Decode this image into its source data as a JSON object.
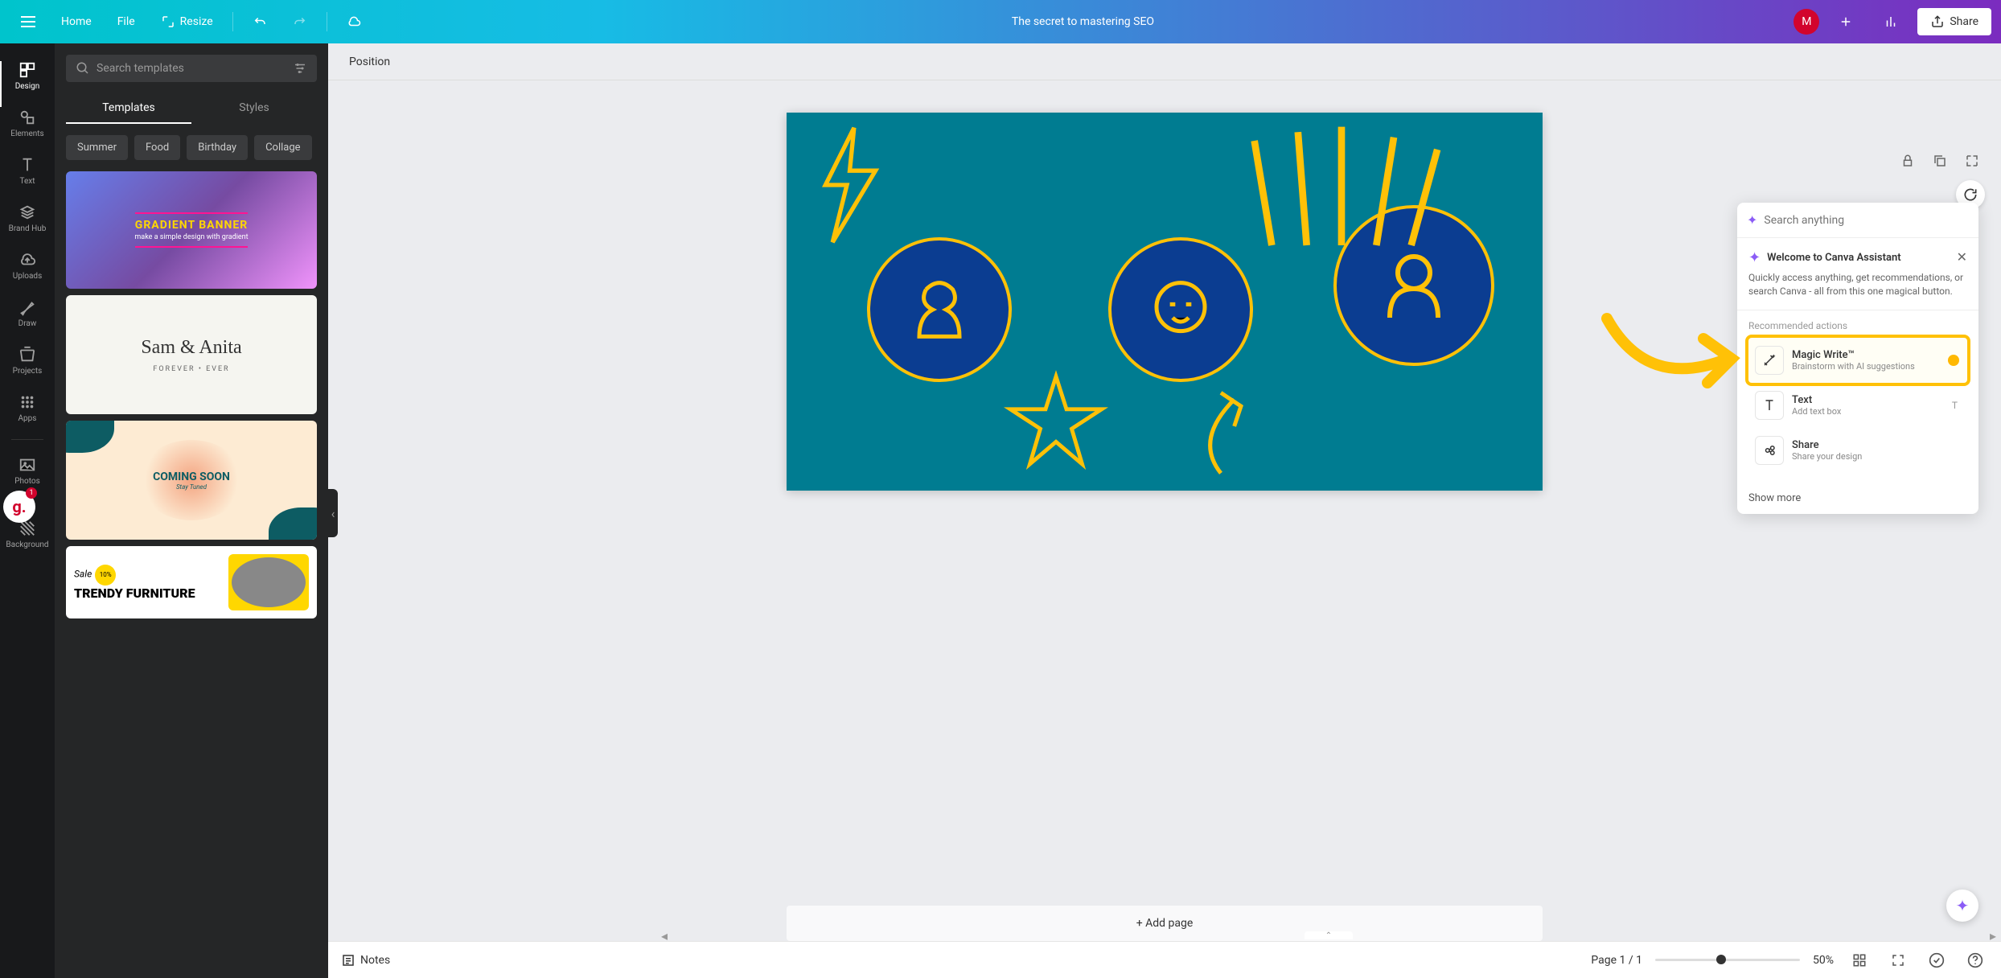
{
  "topbar": {
    "home": "Home",
    "file": "File",
    "resize": "Resize",
    "doc_title": "The secret to mastering SEO",
    "avatar_initial": "M",
    "share": "Share"
  },
  "sidenav": {
    "items": [
      {
        "label": "Design"
      },
      {
        "label": "Elements"
      },
      {
        "label": "Text"
      },
      {
        "label": "Brand Hub"
      },
      {
        "label": "Uploads"
      },
      {
        "label": "Draw"
      },
      {
        "label": "Projects"
      },
      {
        "label": "Apps"
      },
      {
        "label": "Photos"
      },
      {
        "label": "Background"
      }
    ],
    "badge_count": "1"
  },
  "panel": {
    "search_placeholder": "Search templates",
    "tabs": {
      "templates": "Templates",
      "styles": "Styles"
    },
    "chips": [
      "Summer",
      "Food",
      "Birthday",
      "Collage"
    ],
    "templates": {
      "t1": {
        "title": "GRADIENT BANNER",
        "sub": "make a simple design with gradient"
      },
      "t2": {
        "title": "Sam & Anita",
        "sub": "FOREVER • EVER"
      },
      "t3": {
        "title": "COMING SOON",
        "sub": "Stay Tuned"
      },
      "t4": {
        "sale": "Sale",
        "pct": "10%",
        "title": "TRENDY FURNITURE"
      }
    }
  },
  "toolbar": {
    "position": "Position"
  },
  "canvas": {
    "add_page": "+ Add page"
  },
  "assistant": {
    "search_placeholder": "Search anything",
    "welcome": {
      "title": "Welcome to Canva Assistant",
      "desc": "Quickly access anything, get recommendations, or search Canva - all from this one magical button."
    },
    "section_label": "Recommended actions",
    "actions": {
      "magic": {
        "title": "Magic Write™",
        "sub": "Brainstorm with AI suggestions"
      },
      "text": {
        "title": "Text",
        "sub": "Add text box",
        "key": "T"
      },
      "share": {
        "title": "Share",
        "sub": "Share your design"
      }
    },
    "show_more": "Show more"
  },
  "bottombar": {
    "notes": "Notes",
    "page_indicator": "Page 1 / 1",
    "zoom": "50%"
  },
  "colors": {
    "accent_yellow": "#FFC107",
    "canvas_bg": "#007C91",
    "sparkle": "#8B5CF6"
  }
}
